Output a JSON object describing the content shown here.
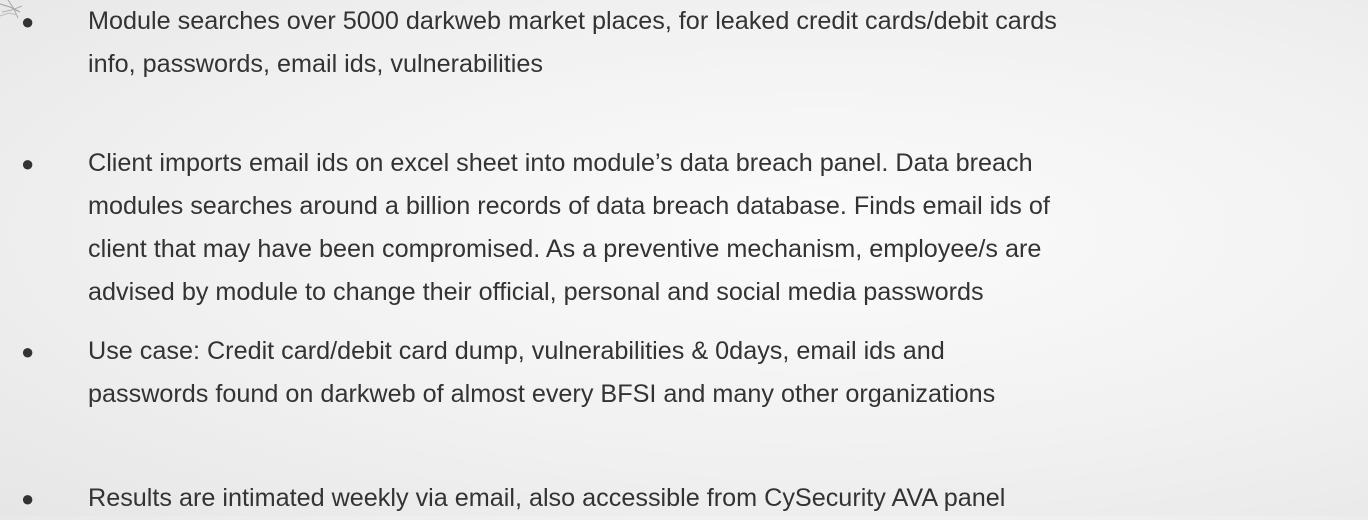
{
  "bullets": [
    {
      "text": "Module searches over 5000 darkweb market places, for leaked credit cards/debit cards\ninfo, passwords, email ids, vulnerabilities"
    },
    {
      "text": "Client imports email ids on excel sheet into module’s data breach panel. Data breach\nmodules searches around a billion records of data breach database. Finds email ids of\nclient that may have been compromised. As a preventive mechanism, employee/s are\nadvised by module to change their official, personal and social media passwords"
    },
    {
      "text": "Use case: Credit card/debit card dump, vulnerabilities & 0days, email ids and\npasswords found on darkweb of almost every BFSI and many other organizations"
    },
    {
      "text": "Results are intimated weekly via email, also accessible from CySecurity  AVA panel"
    }
  ],
  "bullet_symbol": "●",
  "colors": {
    "text": "#333333",
    "background": "#f1f1f1",
    "decoration": "#9a9a9a"
  }
}
